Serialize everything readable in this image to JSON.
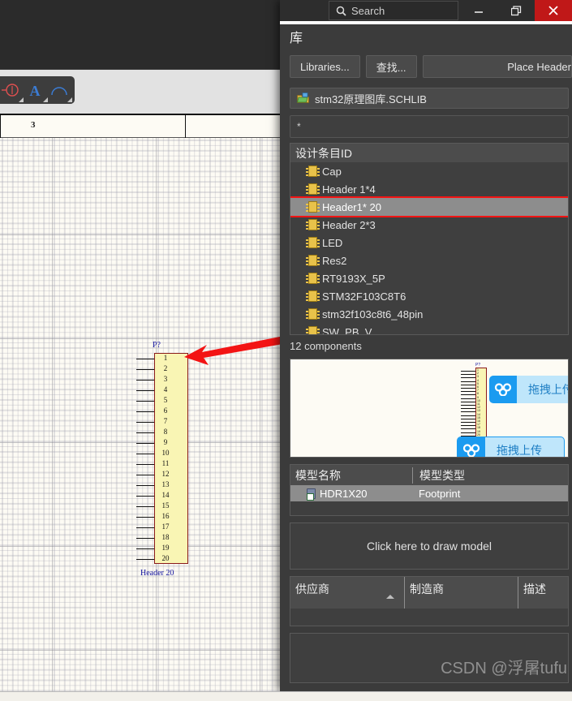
{
  "titlebar": {
    "search_placeholder": "Search",
    "search_icon": "search-icon",
    "minimize_label": "—",
    "restore_label": "❐",
    "close_label": "✕"
  },
  "panel": {
    "title": "库",
    "buttons": {
      "libraries": "Libraries...",
      "find": "查找...",
      "place": "Place Header"
    },
    "library_select": {
      "value": "stm32原理图库.SCHLIB",
      "icon": "library-folder-icon"
    },
    "filter": {
      "value": "*",
      "placeholder": "*"
    },
    "list": {
      "column_header": "设计条目ID",
      "items": [
        {
          "name": "Cap",
          "selected": false
        },
        {
          "name": "Header 1*4",
          "selected": false
        },
        {
          "name": "Header1* 20",
          "selected": true
        },
        {
          "name": "Header 2*3",
          "selected": false
        },
        {
          "name": "LED",
          "selected": false
        },
        {
          "name": "Res2",
          "selected": false
        },
        {
          "name": "RT9193X_5P",
          "selected": false
        },
        {
          "name": "STM32F103C8T6",
          "selected": false
        },
        {
          "name": "stm32f103c8t6_48pin",
          "selected": false
        },
        {
          "name": "SW_PB_V",
          "selected": false
        }
      ],
      "count_label": "12 components"
    },
    "preview": {
      "reference": "P?",
      "upload_badges": [
        {
          "label": "拖拽上传",
          "icon": "cloud-upload-icon"
        },
        {
          "label": "拖拽上传",
          "icon": "cloud-upload-icon"
        }
      ]
    },
    "models": {
      "headers": [
        "模型名称",
        "模型类型"
      ],
      "rows": [
        {
          "name": "HDR1X20",
          "type": "Footprint",
          "icon": "footprint-icon",
          "selected": true
        }
      ],
      "draw_hint": "Click here to draw model"
    },
    "suppliers": {
      "headers": [
        "供应商",
        "制造商",
        "描述"
      ],
      "rows": []
    }
  },
  "editor": {
    "ruler_labels": [
      {
        "text": "3",
        "x": 42
      }
    ],
    "toolbar_icons": [
      {
        "name": "net-label-icon"
      },
      {
        "name": "text-string-icon"
      },
      {
        "name": "arc-icon"
      }
    ],
    "symbol": {
      "reference": "P?",
      "footprint_label": "Header 20",
      "pins": [
        "1",
        "2",
        "3",
        "4",
        "5",
        "6",
        "7",
        "8",
        "9",
        "10",
        "11",
        "12",
        "13",
        "14",
        "15",
        "16",
        "17",
        "18",
        "19",
        "20"
      ]
    },
    "annotation": {
      "type": "arrow",
      "color": "#f31414",
      "direction": "left"
    }
  },
  "watermark": {
    "text": "CSDN @浮屠tufu"
  },
  "colors": {
    "panel_bg": "#3b3b3b",
    "selection": "#8d8d8d",
    "highlight_box": "#f31414",
    "close_button": "#c01818",
    "canvas_bg": "#fdfbf4",
    "symbol_fill": "#f9f5b4",
    "symbol_border": "#8a1a1a",
    "upload_accent": "#1b9bf0"
  }
}
